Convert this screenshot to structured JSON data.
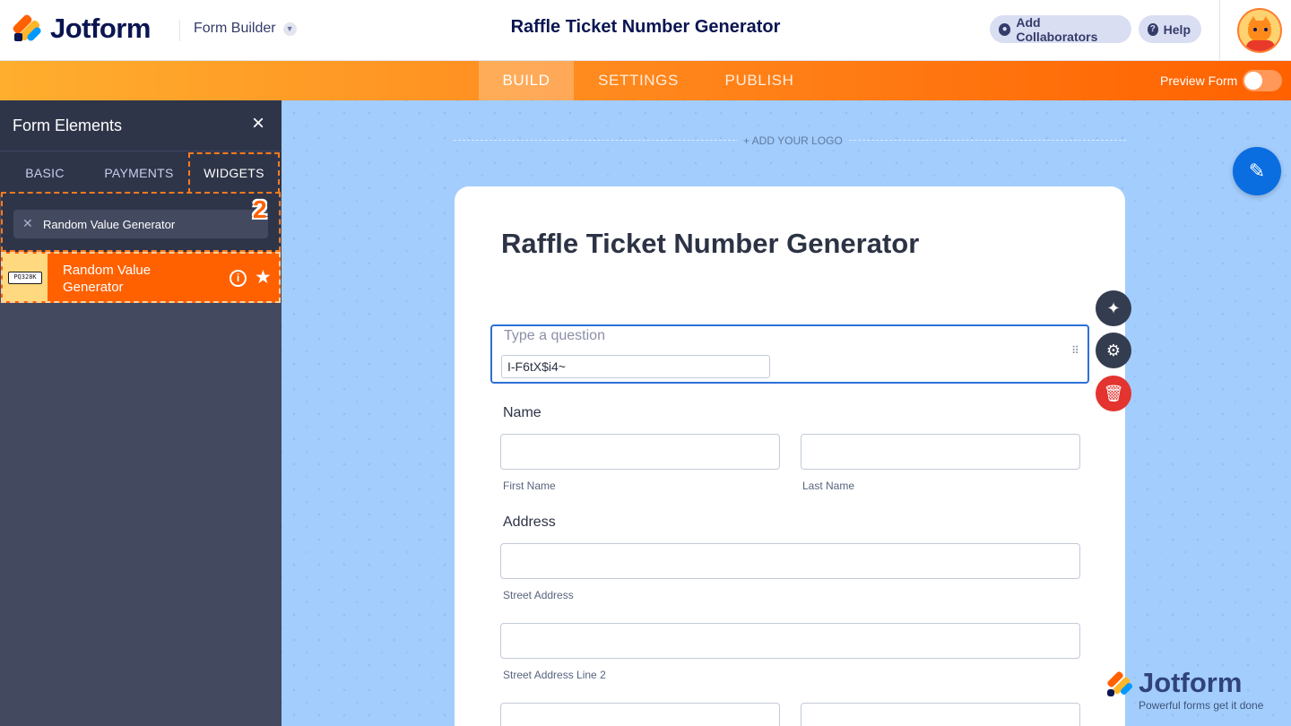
{
  "header": {
    "brand": "Jotform",
    "product": "Form Builder",
    "form_title": "Raffle Ticket Number Generator",
    "add_collaborators": "Add Collaborators",
    "help": "Help"
  },
  "nav": {
    "tabs": [
      {
        "label": "BUILD",
        "active": true
      },
      {
        "label": "SETTINGS",
        "active": false
      },
      {
        "label": "PUBLISH",
        "active": false
      }
    ],
    "preview_label": "Preview Form",
    "preview_enabled": false
  },
  "sidebar": {
    "title": "Form Elements",
    "tabs": [
      "BASIC",
      "PAYMENTS",
      "WIDGETS"
    ],
    "active_tab": "WIDGETS",
    "search_value": "Random Value Generator",
    "step_badge": "2",
    "results": [
      {
        "name": "Random Value Generator",
        "thumb_text": "PQ328K"
      }
    ]
  },
  "canvas": {
    "add_logo": "+ ADD YOUR LOGO",
    "form_title": "Raffle Ticket Number Generator",
    "selected_question": {
      "placeholder": "Type a question",
      "value": "I-F6tX$i4~"
    },
    "fields": {
      "name_label": "Name",
      "first_name": "First Name",
      "last_name": "Last Name",
      "address_label": "Address",
      "street_address": "Street Address",
      "street_address_2": "Street Address Line 2"
    },
    "watermark": {
      "brand": "Jotform",
      "tagline": "Powerful forms get it done"
    }
  },
  "colors": {
    "brand_navy": "#0a1551",
    "orange": "#ff6100",
    "canvas_blue": "#a3cdfd",
    "selection_blue": "#2e6fd8",
    "delete_red": "#e3342f"
  },
  "icons": [
    "user-icon",
    "help-icon",
    "chevron-down-icon",
    "close-icon",
    "info-icon",
    "star-icon",
    "magic-wand-icon",
    "gear-icon",
    "trash-icon",
    "paint-roller-icon",
    "drag-handle-icon"
  ]
}
